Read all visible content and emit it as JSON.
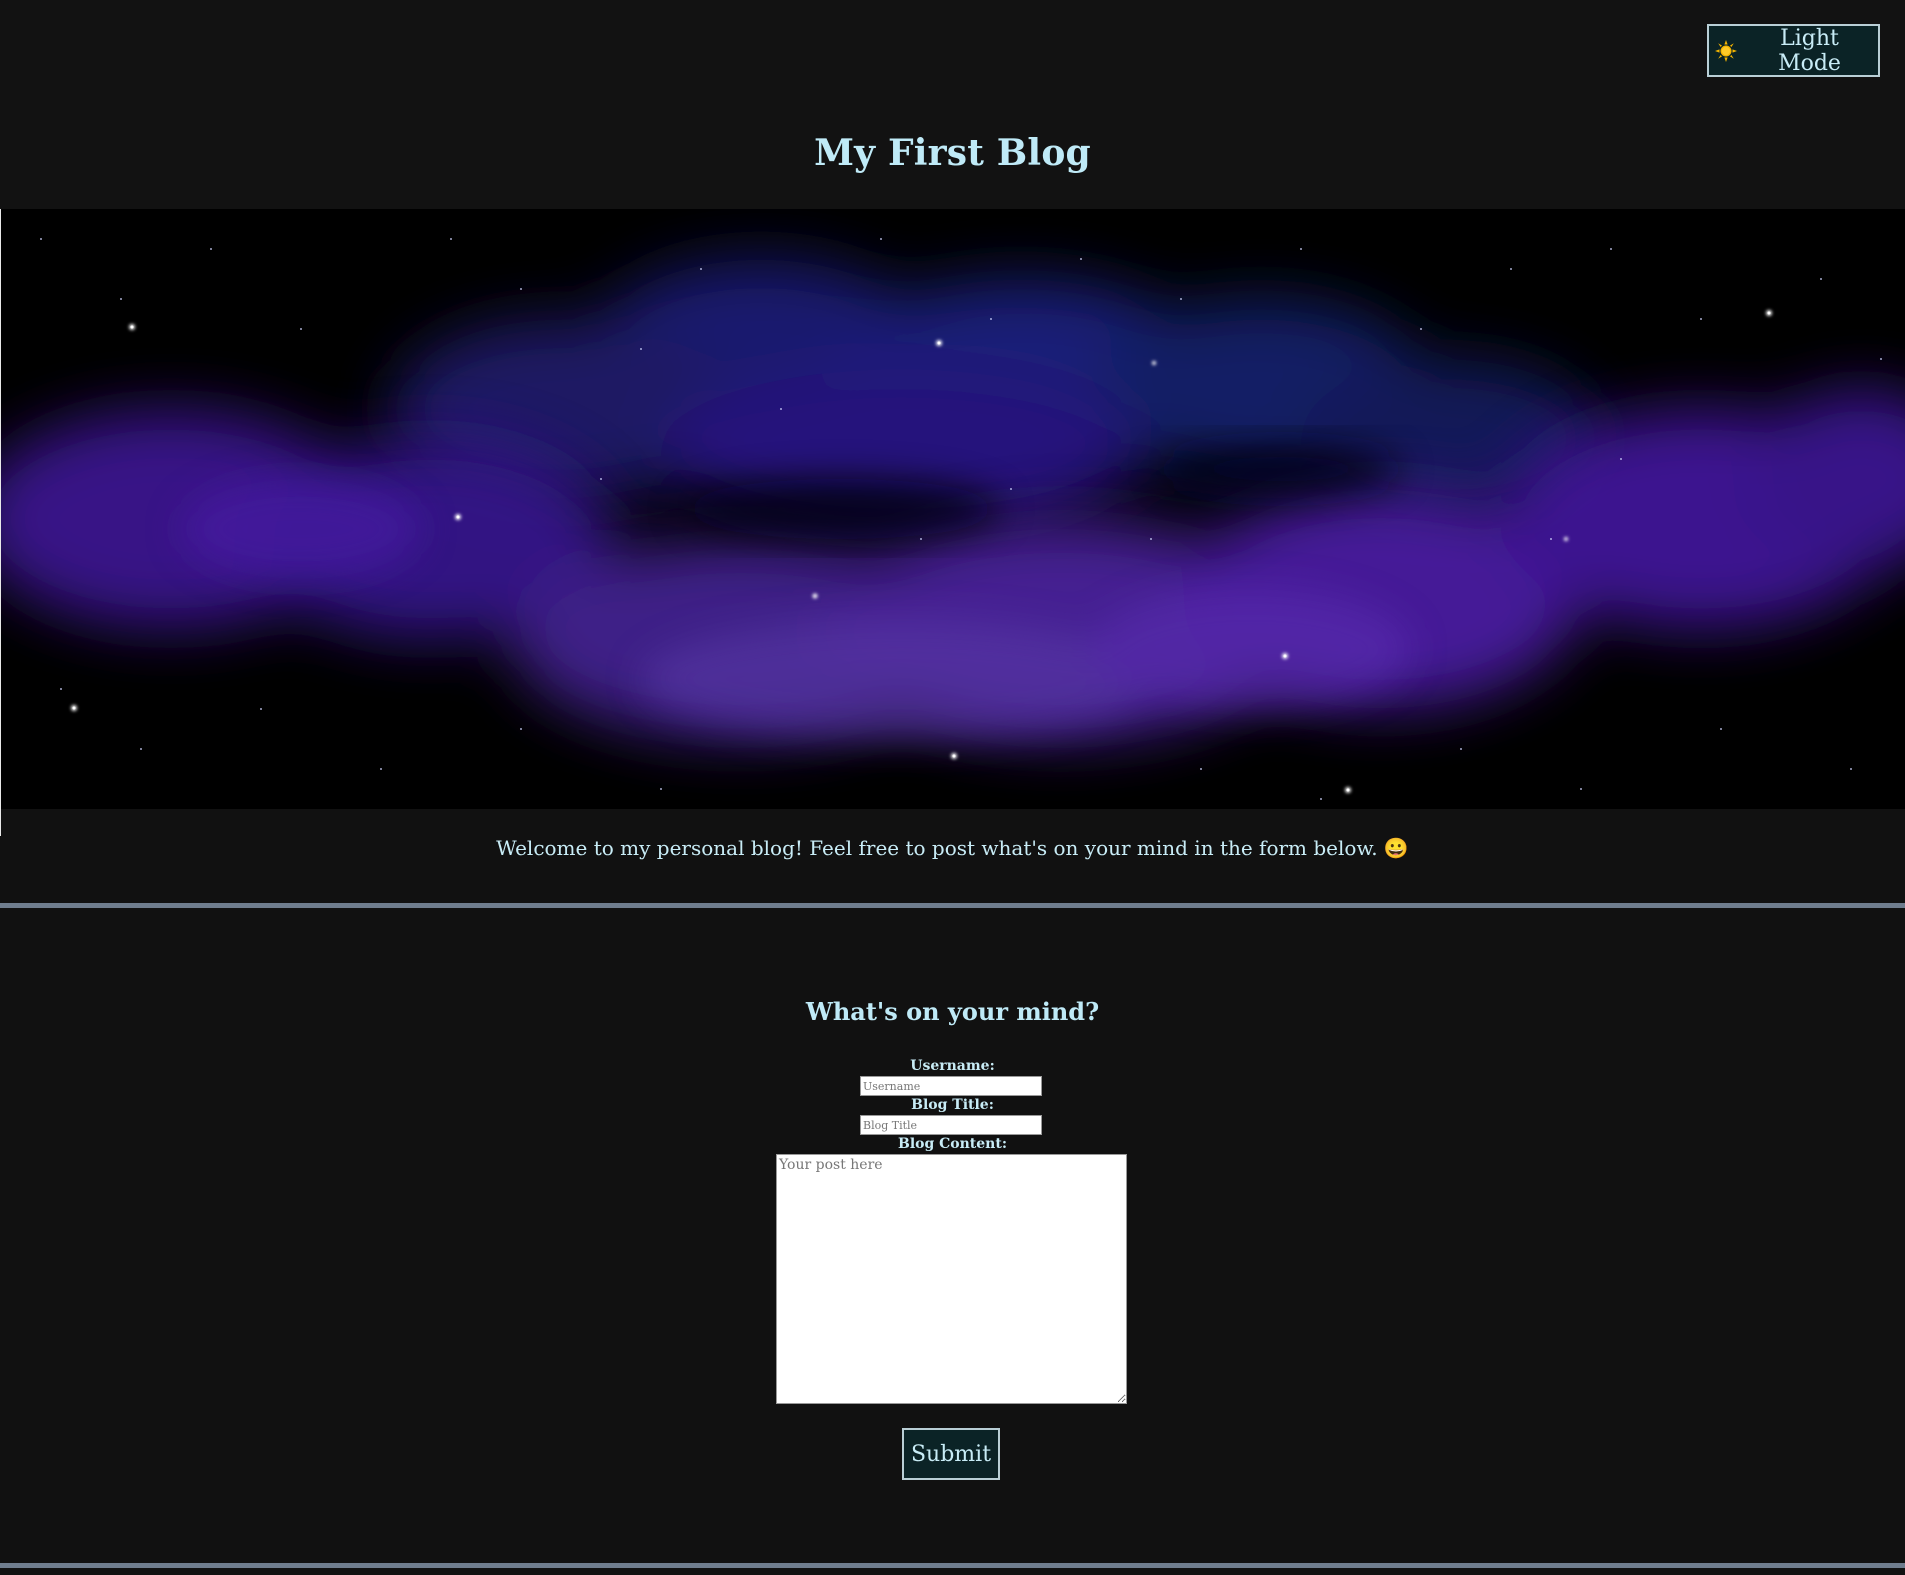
{
  "header": {
    "theme_button_label": "Light Mode",
    "theme_button_icon": "sun-icon",
    "title": "My First Blog"
  },
  "hero": {
    "image": "space-nebula-banner"
  },
  "welcome": {
    "text": "Welcome to my personal blog! Feel free to post what's on your mind in the form below. 😀"
  },
  "form": {
    "title": "What's on your mind?",
    "username_label": "Username:",
    "username_placeholder": "Username",
    "blog_title_label": "Blog Title:",
    "blog_title_placeholder": "Blog Title",
    "blog_content_label": "Blog Content:",
    "blog_content_placeholder": "Your post here",
    "submit_label": "Submit"
  },
  "colors": {
    "background": "#111111",
    "text": "#c8ecf6",
    "button_bg": "#0b2326",
    "divider": "#6f7d8e"
  }
}
